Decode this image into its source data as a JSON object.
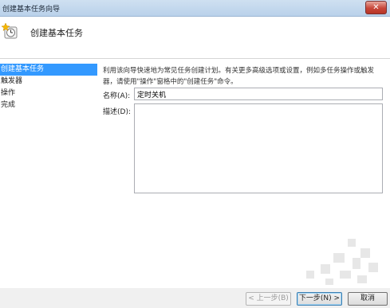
{
  "window": {
    "title": "创建基本任务向导",
    "close_glyph": "✕"
  },
  "header": {
    "icon": "wizard-clock-icon",
    "heading": "创建基本任务"
  },
  "nav": {
    "items": [
      "创建基本任务",
      "触发器",
      "操作",
      "完成"
    ],
    "active_index": 0
  },
  "main": {
    "intro_line1": "利用该向导快速地为常见任务创建计划。有关更多高级选项或设置，例如多任务操作或触发",
    "intro_line2": "器，请使用\"操作\"窗格中的\"创建任务\"命令。",
    "name_label": "名称(A):",
    "name_value": "定时关机",
    "desc_label": "描述(D):",
    "desc_value": ""
  },
  "footer": {
    "back_label": "< 上一步(B)",
    "next_label": "下一步(N) >",
    "cancel_label": "取消"
  },
  "colors": {
    "accent": "#3399ff",
    "titlebar": "#c6dcf2",
    "close": "#c8473a"
  }
}
